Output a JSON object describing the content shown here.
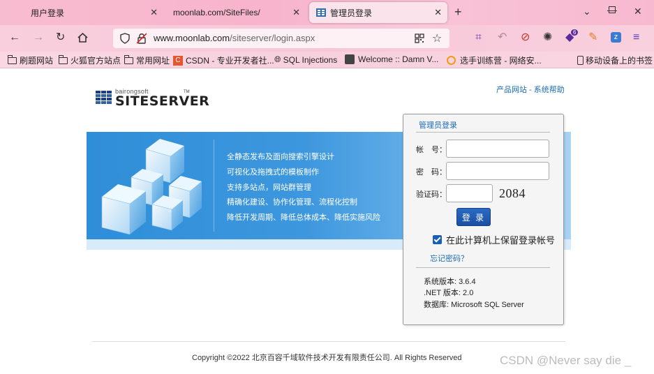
{
  "browser": {
    "tabs": [
      {
        "label": "用户登录"
      },
      {
        "label": "moonlab.com/SiteFiles/"
      },
      {
        "label": "管理员登录",
        "active": true
      }
    ],
    "new_tab": "+",
    "url_host": "www.moonlab.com",
    "url_path": "/siteserver/login.aspx",
    "bookmarks": [
      "刷题网站",
      "火狐官方站点",
      "常用网址",
      "CSDN - 专业开发者社...",
      "SQL Injections",
      "Welcome :: Damn V...",
      "选手训练营 - 网络安...",
      "移动设备上的书签"
    ],
    "extension_badge": "6"
  },
  "page": {
    "logo_small": "bairongsoft",
    "logo_big": "SITESERVER",
    "logo_tm": "TM",
    "top_links": {
      "product": "产品网站",
      "sep": " - ",
      "help": "系统帮助"
    },
    "features": [
      "全静态发布及面向搜索引擎设计",
      "可视化及拖拽式的模板制作",
      "支持多站点，网站群管理",
      "精确化建设、协作化管理、流程化控制",
      "降低开发周期、降低总体成本、降低实施风险"
    ],
    "login": {
      "title": "管理员登录",
      "account_label": "帐　号：",
      "password_label": "密　码：",
      "captcha_label": "验证码：",
      "account_value": "",
      "password_value": "",
      "captcha_value": "",
      "captcha_code": "2084",
      "submit": "登 录",
      "remember": "在此计算机上保留登录帐号",
      "forgot": "忘记密码？",
      "version": "系统版本: 3.6.4",
      "net_version": ".NET 版本: 2.0",
      "database": "数据库: Microsoft SQL Server"
    },
    "copyright": "Copyright ©2022 北京百容千域软件技术开发有限责任公司. All Rights Reserved",
    "watermark": "CSDN @Never say die _"
  },
  "colors": {
    "link": "#1b6bb8",
    "banner": "#3d97de",
    "button": "#1a4fa3",
    "tabbar": "#f7b4cc"
  }
}
